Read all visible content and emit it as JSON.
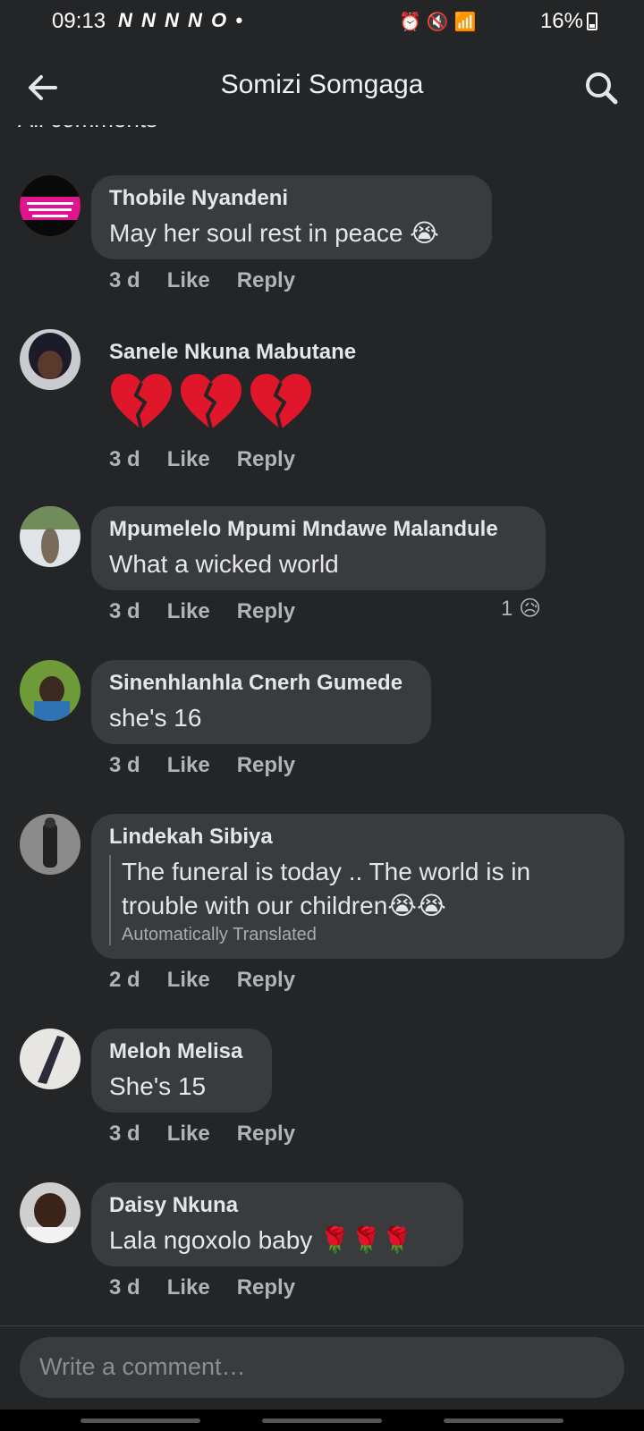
{
  "status_bar": {
    "time": "09:13",
    "notifications": "N N N N O •",
    "battery": "16%"
  },
  "header": {
    "title": "Somizi Somgaga"
  },
  "section": {
    "title": "All comments"
  },
  "comments": [
    {
      "author": "Thobile Nyandeni",
      "text": "May her soul rest in peace 😭",
      "time": "3 d",
      "like": "Like",
      "reply": "Reply"
    },
    {
      "author": "Sanele Nkuna Mabutane",
      "time": "3 d",
      "like": "Like",
      "reply": "Reply"
    },
    {
      "author": "Mpumelelo Mpumi Mndawe Malandule",
      "text": "What a wicked world",
      "time": "3 d",
      "like": "Like",
      "reply": "Reply",
      "reaction_count": "1"
    },
    {
      "author": "Sinenhlanhla Cnerh Gumede",
      "text": "she's 16",
      "time": "3 d",
      "like": "Like",
      "reply": "Reply"
    },
    {
      "author": "Lindekah Sibiya",
      "text": "The funeral is today .. The world is in trouble with our children😭😭",
      "translated_note": "Automatically Translated",
      "time": "2 d",
      "like": "Like",
      "reply": "Reply"
    },
    {
      "author": "Meloh Melisa",
      "text": "She's 15",
      "time": "3 d",
      "like": "Like",
      "reply": "Reply"
    },
    {
      "author": "Daisy Nkuna",
      "text": "Lala ngoxolo baby 🌹🌹🌹",
      "time": "3 d",
      "like": "Like",
      "reply": "Reply"
    }
  ],
  "composer": {
    "placeholder": "Write a comment…"
  },
  "colors": {
    "background": "#242526",
    "bubble": "#3a3b3c",
    "text": "#e4e6eb",
    "muted": "#b0b3b8"
  },
  "icons": {
    "back": "arrow-left-icon",
    "search": "search-icon",
    "heart": "broken-heart-icon"
  }
}
